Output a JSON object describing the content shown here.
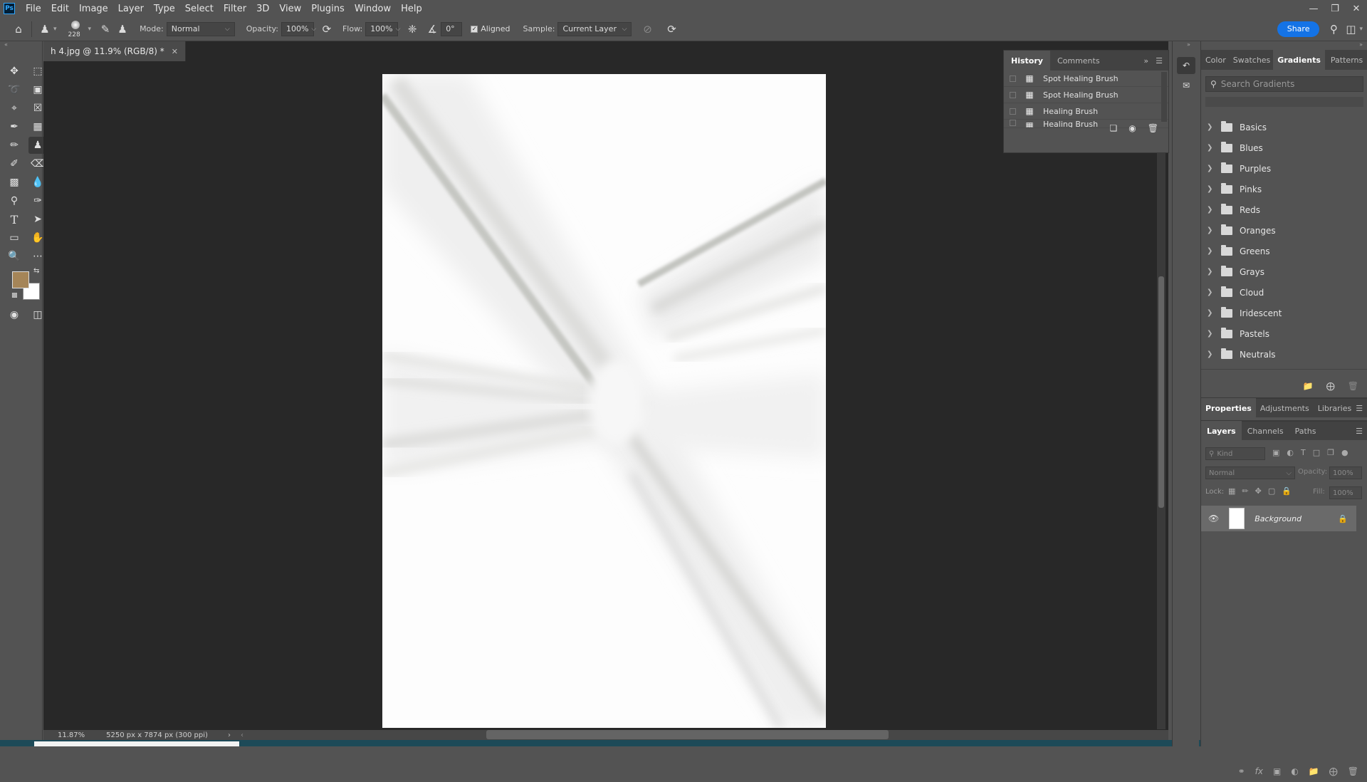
{
  "app": {
    "logo": "Ps"
  },
  "menu": [
    "File",
    "Edit",
    "Image",
    "Layer",
    "Type",
    "Select",
    "Filter",
    "3D",
    "View",
    "Plugins",
    "Window",
    "Help"
  ],
  "options": {
    "brush_size": "228",
    "mode_label": "Mode:",
    "mode_value": "Normal",
    "opacity_label": "Opacity:",
    "opacity_value": "100%",
    "flow_label": "Flow:",
    "flow_value": "100%",
    "angle_value": "0°",
    "aligned_label": "Aligned",
    "sample_label": "Sample:",
    "sample_value": "Current Layer",
    "share_label": "Share"
  },
  "document": {
    "tab_title": "h 4.jpg @ 11.9% (RGB/8) *",
    "zoom": "11.87%",
    "doc_info": "5250 px x 7874 px (300 ppi)"
  },
  "colors": {
    "foreground": "#a58558",
    "background": "#ffffff",
    "accent": "#1473e6"
  },
  "history": {
    "tabs": [
      "History",
      "Comments"
    ],
    "items": [
      "Spot Healing Brush",
      "Spot Healing Brush",
      "Healing Brush",
      "Healing Brush"
    ]
  },
  "gradients_panel": {
    "tabs": [
      "Color",
      "Swatches",
      "Gradients",
      "Patterns"
    ],
    "search_placeholder": "Search Gradients",
    "folders": [
      "Basics",
      "Blues",
      "Purples",
      "Pinks",
      "Reds",
      "Oranges",
      "Greens",
      "Grays",
      "Cloud",
      "Iridescent",
      "Pastels",
      "Neutrals"
    ]
  },
  "properties_tabs": [
    "Properties",
    "Adjustments",
    "Libraries"
  ],
  "layers_panel": {
    "tabs": [
      "Layers",
      "Channels",
      "Paths"
    ],
    "kind_placeholder": "Kind",
    "blend_mode": "Normal",
    "opacity_label": "Opacity:",
    "opacity_value": "100%",
    "lock_label": "Lock:",
    "fill_label": "Fill:",
    "fill_value": "100%",
    "layers": [
      {
        "name": "Background"
      }
    ]
  }
}
